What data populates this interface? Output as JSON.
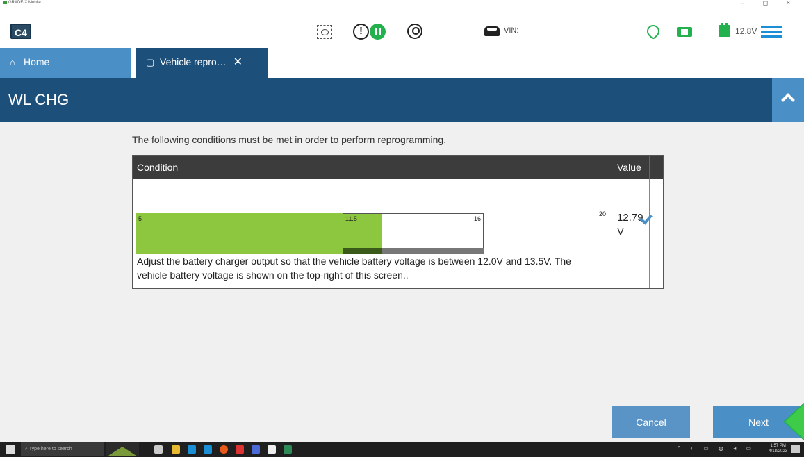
{
  "window": {
    "title": "GRADE-X Mobile",
    "controls": "–  ◻  ×"
  },
  "toolbar": {
    "logo": "C4",
    "vin_label": "VIN:",
    "voltage": "12.8V",
    "icons": [
      "screenshot-icon",
      "alert-icon",
      "pause-icon",
      "user-icon",
      "car-icon",
      "wifi-icon",
      "connection-icon",
      "battery-icon",
      "menu-icon"
    ],
    "accent_color": "#1a8fd6",
    "status_color": "#22b14c"
  },
  "tabs": [
    {
      "label": "Home",
      "icon": "home-icon"
    },
    {
      "label": "Vehicle repro…",
      "icon": "chip-icon"
    }
  ],
  "header": {
    "title": "WL CHG"
  },
  "main": {
    "intro": "The following conditions must be met in order to perform reprogramming.",
    "table": {
      "headers": [
        "Condition",
        "Value"
      ],
      "gauge": {
        "ticks": [
          "5",
          "11.5",
          "16",
          "20"
        ]
      },
      "description": "Adjust the battery charger output so that the vehicle battery voltage is between 12.0V and 13.5V. The vehicle battery voltage is shown on the top-right of this screen..",
      "value": "12.79 V"
    },
    "buttons": {
      "cancel": "Cancel",
      "next": "Next"
    }
  },
  "taskbar": {
    "search_placeholder": "Type here to search",
    "time": "1:57 PM",
    "date": "4/18/2023"
  }
}
